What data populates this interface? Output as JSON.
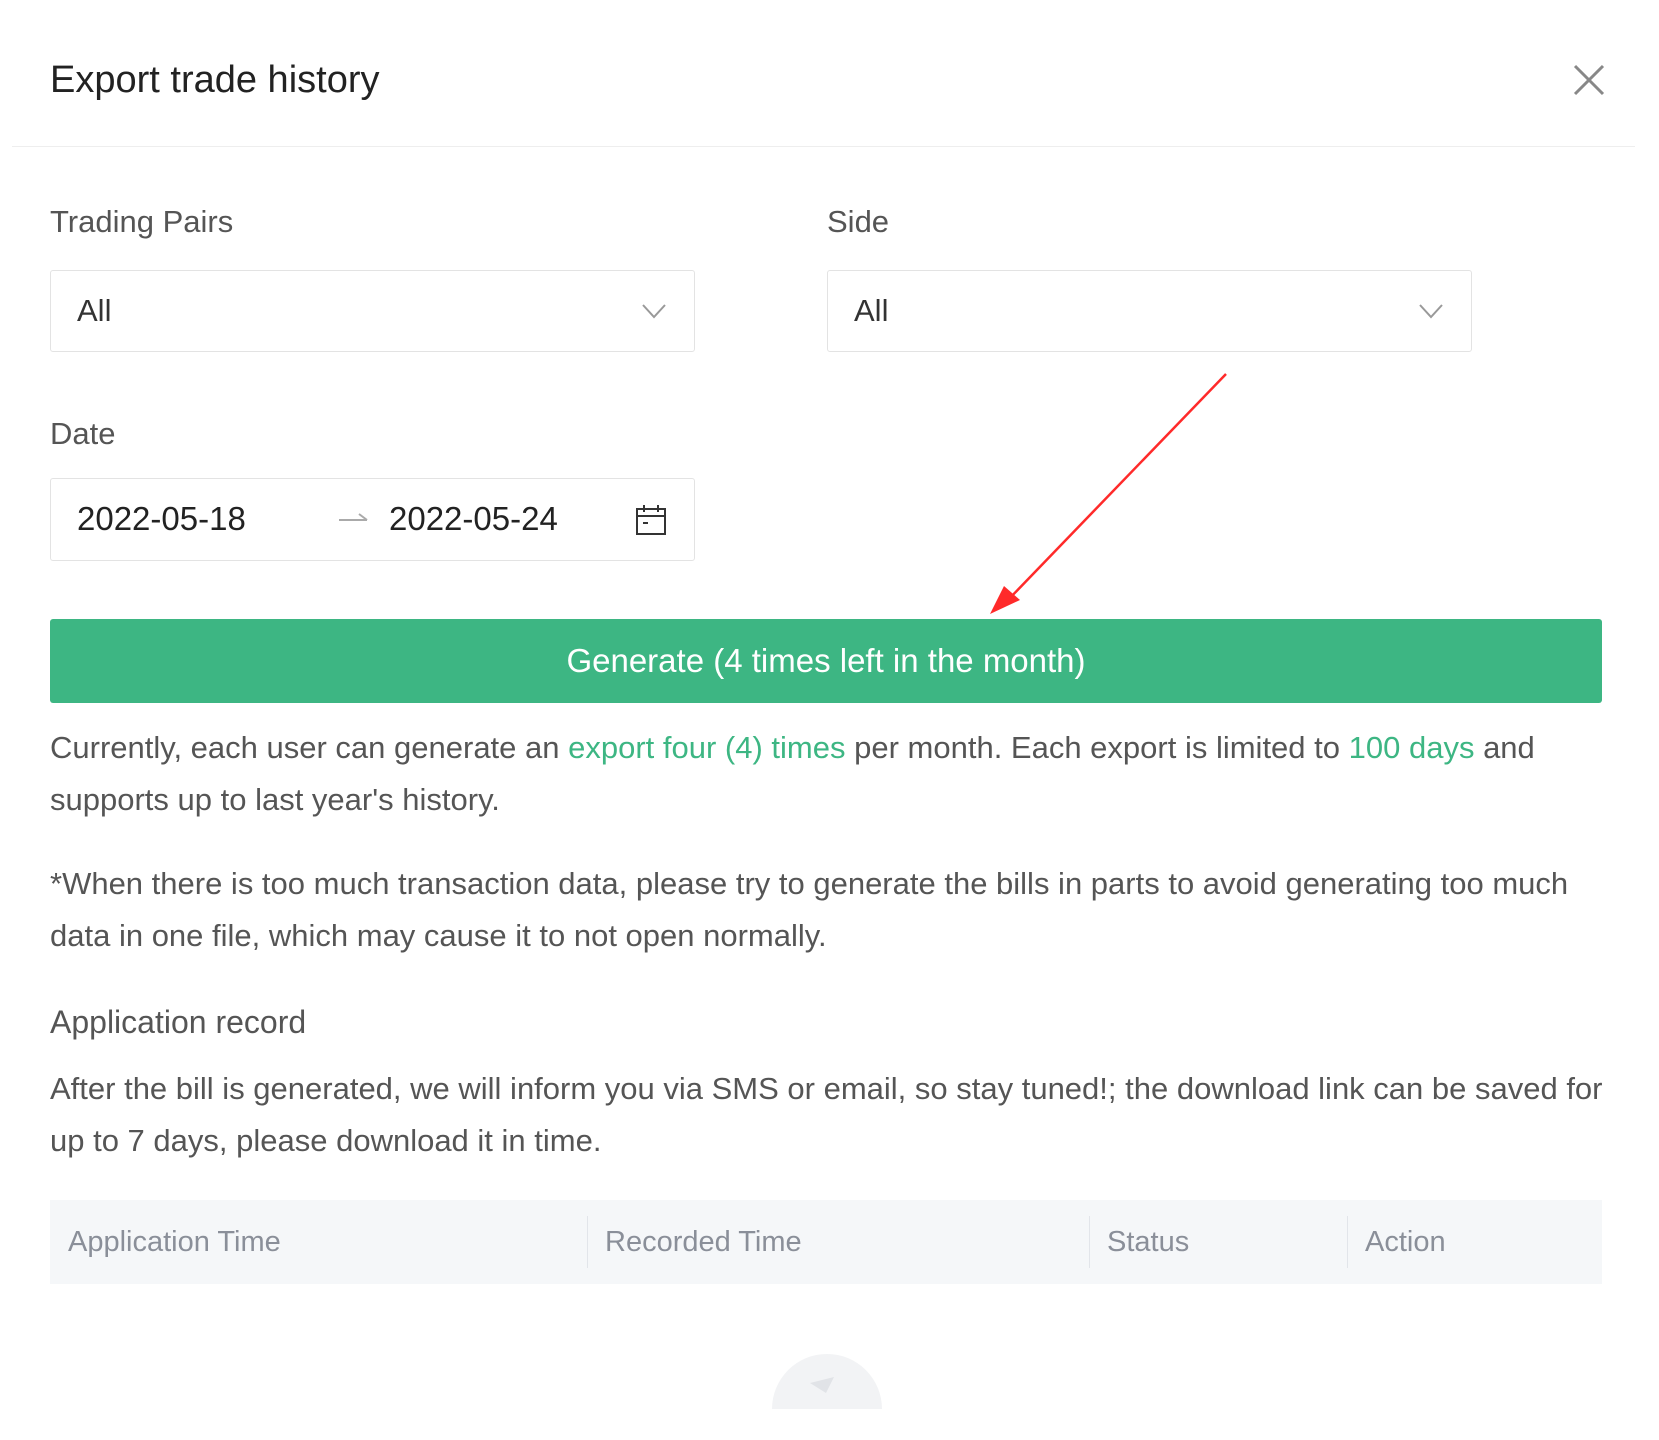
{
  "dialog": {
    "title": "Export trade history",
    "close_icon": "close-icon"
  },
  "filters": {
    "trading_pairs": {
      "label": "Trading Pairs",
      "value": "All"
    },
    "side": {
      "label": "Side",
      "value": "All"
    },
    "date": {
      "label": "Date",
      "start": "2022-05-18",
      "end": "2022-05-24",
      "separator_icon": "arrow-right-icon",
      "calendar_icon": "calendar-icon"
    }
  },
  "generate_button": {
    "label": "Generate (4 times left in the month)"
  },
  "info": {
    "p1_part1": "Currently, each user can generate an ",
    "p1_highlight1": "export four (4) times",
    "p1_part2": " per month. Each export is limited to ",
    "p1_highlight2": "100 days",
    "p1_part3": " and supports up to last year's history.",
    "p2": "*When there is too much transaction data, please try to generate the bills in parts to avoid generating too much data in one file, which may cause it to not open normally."
  },
  "application_record": {
    "title": "Application record",
    "description": "After the bill is generated, we will inform you via SMS or email, so stay tuned!; the download link can be saved for up to 7 days, please download it in time.",
    "columns": [
      "Application Time",
      "Recorded Time",
      "Status",
      "Action"
    ],
    "empty_icon": "empty-state-icon"
  },
  "colors": {
    "accent": "#3db683",
    "annotation_arrow": "#ff0000"
  }
}
